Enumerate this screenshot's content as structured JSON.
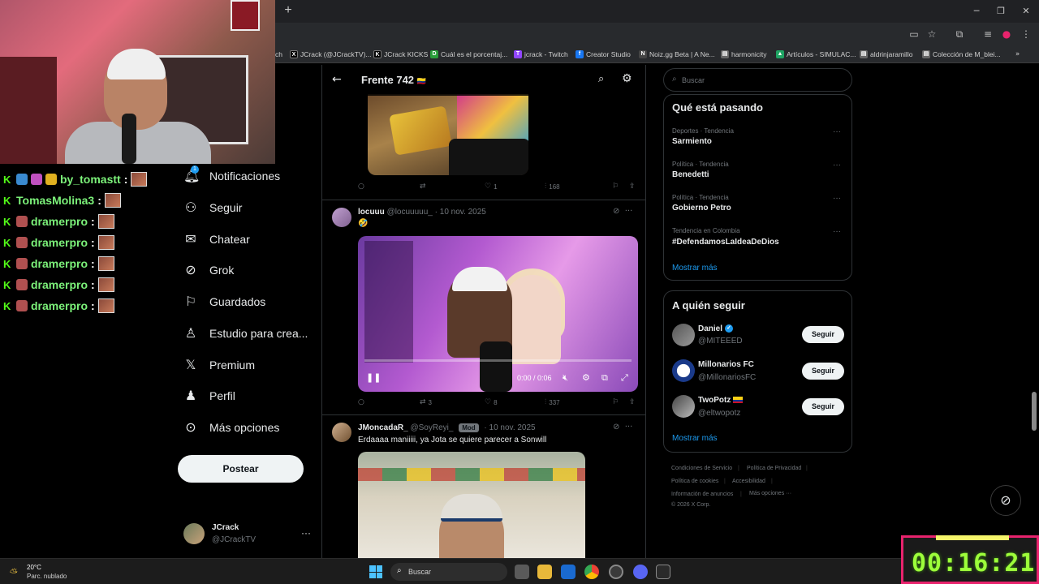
{
  "browser": {
    "bookmarks": [
      {
        "label": "ch",
        "icon": "none"
      },
      {
        "label": "JCrack (@JCrackTV)...",
        "icon": "x-icon"
      },
      {
        "label": "JCrack KICKS",
        "icon": "kick-icon"
      },
      {
        "label": "Cuál es el porcentaj...",
        "icon": "doc-icon"
      },
      {
        "label": "jcrack - Twitch",
        "icon": "twitch-icon"
      },
      {
        "label": "Creator Studio",
        "icon": "facebook-icon"
      },
      {
        "label": "Noiz.gg Beta | A Ne...",
        "icon": "noiz-icon"
      },
      {
        "label": "harmonicity",
        "icon": "page-icon"
      },
      {
        "label": "Artículos - SIMULAC...",
        "icon": "drive-icon"
      },
      {
        "label": "aldrinjaramillo",
        "icon": "page-icon"
      },
      {
        "label": "Colección de M_blei...",
        "icon": "page-icon"
      }
    ]
  },
  "stream_chat": [
    {
      "user": "by_tomastt",
      "sep": ":"
    },
    {
      "user": "TomasMolina3",
      "sep": ":"
    },
    {
      "user": "dramerpro",
      "sep": ":"
    },
    {
      "user": "dramerpro",
      "sep": ":"
    },
    {
      "user": "dramerpro",
      "sep": ":"
    },
    {
      "user": "dramerpro",
      "sep": ":"
    },
    {
      "user": "dramerpro",
      "sep": ":"
    }
  ],
  "nav": {
    "items": [
      {
        "label": "Notificaciones",
        "icon": "bell-icon"
      },
      {
        "label": "Seguir",
        "icon": "follow-icon"
      },
      {
        "label": "Chatear",
        "icon": "mail-icon"
      },
      {
        "label": "Grok",
        "icon": "grok-icon"
      },
      {
        "label": "Guardados",
        "icon": "bookmark-icon"
      },
      {
        "label": "Estudio para crea...",
        "icon": "studio-icon"
      },
      {
        "label": "Premium",
        "icon": "x-logo-icon"
      },
      {
        "label": "Perfil",
        "icon": "person-icon"
      },
      {
        "label": "Más opciones",
        "icon": "more-circle-icon"
      }
    ],
    "notifications_badge": "1",
    "post_button": "Postear",
    "account": {
      "name": "JCrack",
      "handle": "@JCrackTV",
      "more": "···"
    }
  },
  "header": {
    "title": "Frente 742"
  },
  "feed": {
    "post1": {
      "replies": "",
      "reposts": "",
      "likes": "1",
      "views": "168"
    },
    "post2": {
      "name": "locuuu",
      "handle": "@locuuuuu_",
      "date": "· 10 nov. 2025",
      "text": "🤣",
      "video": {
        "time": "0:00 / 0:06",
        "progress": 0.0
      },
      "replies": "",
      "reposts": "3",
      "likes": "8",
      "views": "337"
    },
    "post3": {
      "name": "JMoncadaR_",
      "handle": "@SoyReyi_",
      "badge": "Mod",
      "date": "· 10 nov. 2025",
      "text": "Erdaaaa maniiiii, ya Jota se quiere parecer a Sonwill"
    }
  },
  "sidebar": {
    "search_placeholder": "Buscar",
    "trends_title": "Qué está pasando",
    "trends": [
      {
        "meta": "Deportes · Tendencia",
        "name": "Sarmiento"
      },
      {
        "meta": "Política · Tendencia",
        "name": "Benedetti"
      },
      {
        "meta": "Política · Tendencia",
        "name": "Gobierno Petro"
      },
      {
        "meta": "Tendencia en Colombia",
        "name": "#DefendamosLaIdeaDeDios"
      }
    ],
    "show_more": "Mostrar más",
    "who_to_follow_title": "A quién seguir",
    "who_to_follow": [
      {
        "name": "Daniel",
        "handle": "@MITEEED",
        "button": "Seguir",
        "verified": true
      },
      {
        "name": "Millonarios FC",
        "handle": "@MillonariosFC",
        "button": "Seguir"
      },
      {
        "name": "TwoPotz",
        "handle": "@eltwopotz",
        "button": "Seguir",
        "flag": "colombia-flag"
      }
    ],
    "show_more_2": "Mostrar más",
    "footer": {
      "terms": "Condiciones de Servicio",
      "privacy": "Política de Privacidad",
      "cookies": "Política de cookies",
      "accessibility": "Accesibilidad",
      "ads": "Información de anuncios",
      "more": "Más opciones ···",
      "copyright": "© 2026 X Corp."
    }
  },
  "taskbar": {
    "weather_temp": "20°C",
    "weather_desc": "Parc. nublado",
    "search_placeholder": "Buscar"
  },
  "timer": {
    "text": "00:16:21"
  },
  "colors": {
    "accent": "#1d9bf0",
    "kick_green": "#53fc18",
    "timer_green": "#9dff3a",
    "timer_border": "#e8236d"
  }
}
